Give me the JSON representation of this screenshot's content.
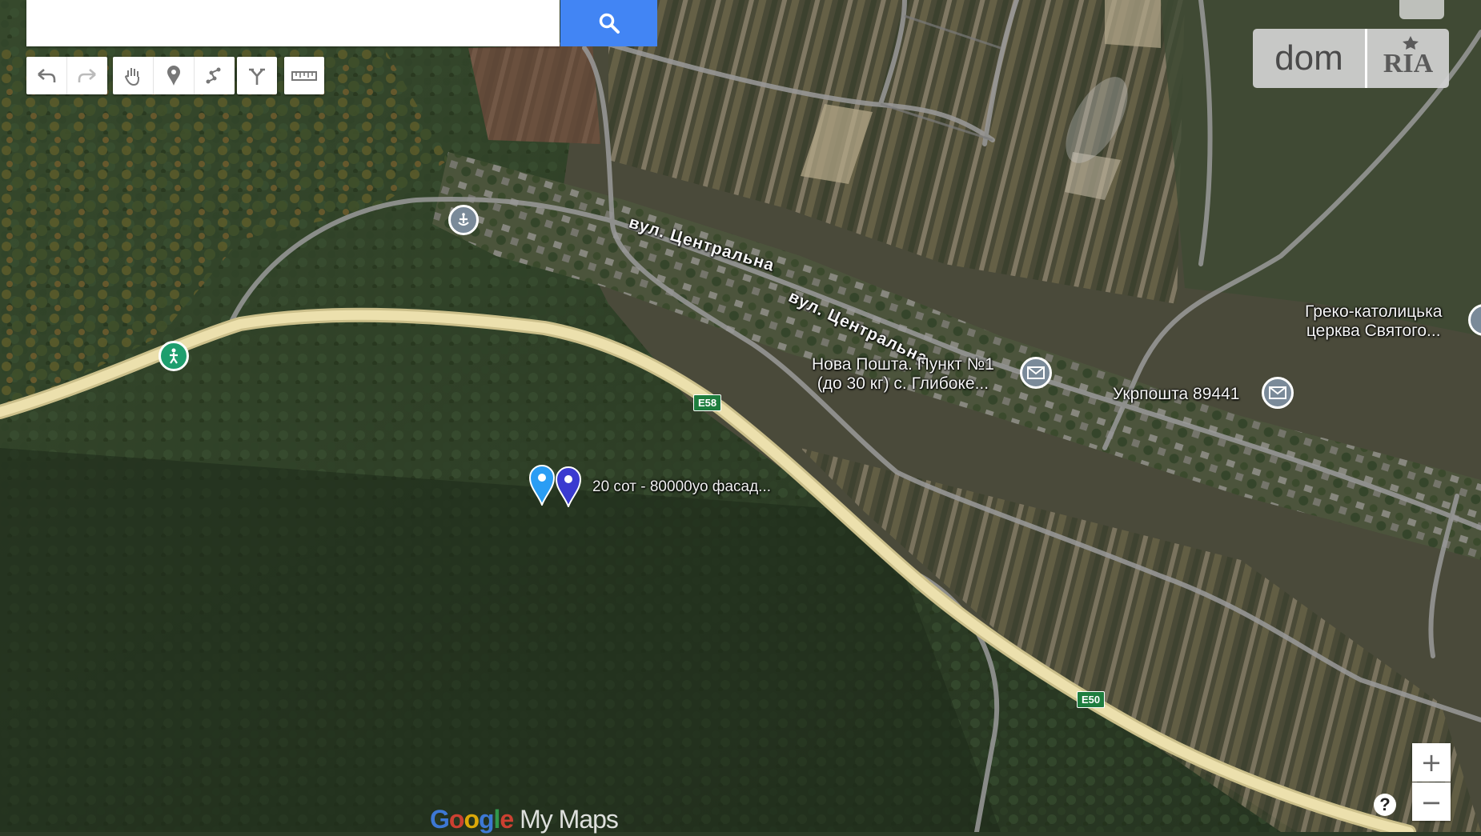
{
  "search": {
    "placeholder": "",
    "button_icon": "search-icon"
  },
  "toolbar": {
    "icons": [
      "undo-icon",
      "redo-icon",
      "hand-icon",
      "add-marker-icon",
      "draw-line-icon",
      "directions-icon",
      "ruler-icon"
    ]
  },
  "logo": {
    "left": "dom",
    "right": "RIA"
  },
  "map": {
    "streets": [
      "вул. Центральна",
      "вул. Центральна"
    ],
    "road_shields": [
      "E58",
      "E50"
    ],
    "pois": {
      "nova_poshta_line1": "Нова Пошта. Пункт №1",
      "nova_poshta_line2": "(до 30 кг) с. Глибоке...",
      "ukrposhta": "Укрпошта 89441",
      "church_line1": "Греко-католицька",
      "church_line2": "церква Святого..."
    },
    "listing_label": "20 сот - 80000уо фасад...",
    "colors": {
      "highway": "#e8d9a0",
      "marker_light": "#2a9df4",
      "marker_dark": "#3a3ad0",
      "poi_green": "#1e9e6e"
    }
  },
  "zoom": {
    "in_label": "+",
    "out_label": "−"
  },
  "help_label": "?",
  "attribution": {
    "google": "Google",
    "mymaps": "My Maps"
  }
}
